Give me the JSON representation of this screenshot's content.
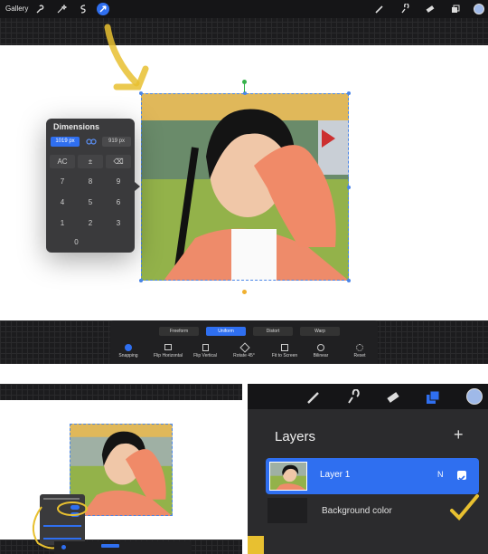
{
  "top_toolbar": {
    "gallery_label": "Gallery"
  },
  "dimensions_panel": {
    "title": "Dimensions",
    "width_value": "1019 px",
    "height_value": "919 px",
    "keys": [
      "AC",
      "±",
      "⌫",
      "7",
      "8",
      "9",
      "4",
      "5",
      "6",
      "1",
      "2",
      "3",
      "0"
    ]
  },
  "transform_modes": {
    "freeform": "Freeform",
    "uniform": "Uniform",
    "distort": "Distort",
    "warp": "Warp",
    "selected": "Uniform"
  },
  "transform_actions": [
    "Snapping",
    "Flip Horizontal",
    "Flip Vertical",
    "Rotate 45°",
    "Fit to Screen",
    "Bilinear",
    "Reset"
  ],
  "layers_panel": {
    "title": "Layers",
    "add_symbol": "+",
    "layer1_name": "Layer 1",
    "layer1_blend": "N",
    "background_name": "Background color"
  },
  "colors": {
    "accent_blue": "#2f6ff0",
    "annotation_yellow": "#e8c030",
    "panel_dark": "#3a3a3c"
  }
}
